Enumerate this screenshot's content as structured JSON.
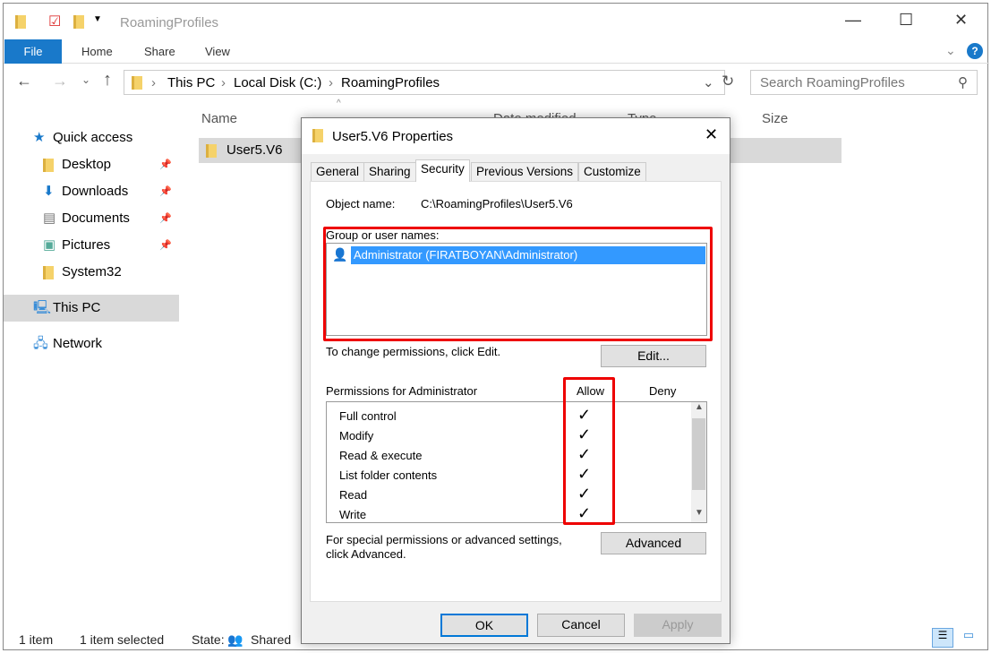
{
  "window": {
    "title": "RoamingProfiles",
    "minimize": "—",
    "maximize": "☐",
    "close": "✕"
  },
  "ribbon": {
    "tabs": [
      "File",
      "Home",
      "Share",
      "View"
    ]
  },
  "address": {
    "crumbs": [
      "This PC",
      "Local Disk (C:)",
      "RoamingProfiles"
    ],
    "search_placeholder": "Search RoamingProfiles"
  },
  "nav": {
    "items": [
      {
        "label": "Quick access",
        "icon": "star-icon"
      },
      {
        "label": "Desktop",
        "icon": "folder-icon",
        "pinned": true
      },
      {
        "label": "Downloads",
        "icon": "download-icon",
        "pinned": true
      },
      {
        "label": "Documents",
        "icon": "document-icon",
        "pinned": true
      },
      {
        "label": "Pictures",
        "icon": "pictures-icon",
        "pinned": true
      },
      {
        "label": "System32",
        "icon": "folder-icon"
      },
      {
        "label": "This PC",
        "icon": "computer-icon",
        "selected": true
      },
      {
        "label": "Network",
        "icon": "network-icon"
      }
    ]
  },
  "columns": [
    "Name",
    "Date modified",
    "Type",
    "Size"
  ],
  "files": [
    {
      "name": "User5.V6"
    }
  ],
  "status": {
    "count": "1 item",
    "selected": "1 item selected",
    "state_label": "State:",
    "state_value": "Shared"
  },
  "dialog": {
    "title": "User5.V6 Properties",
    "tabs": [
      "General",
      "Sharing",
      "Security",
      "Previous Versions",
      "Customize"
    ],
    "active_tab": "Security",
    "object_label": "Object name:",
    "object_value": "C:\\RoamingProfiles\\User5.V6",
    "group_label": "Group or user names:",
    "users": [
      "Administrator (FIRATBOYAN\\Administrator)"
    ],
    "change_text": "To change permissions, click Edit.",
    "edit": "Edit...",
    "perm_label": "Permissions for Administrator",
    "allow": "Allow",
    "deny": "Deny",
    "permissions": [
      {
        "name": "Full control",
        "allow": true,
        "deny": false
      },
      {
        "name": "Modify",
        "allow": true,
        "deny": false
      },
      {
        "name": "Read & execute",
        "allow": true,
        "deny": false
      },
      {
        "name": "List folder contents",
        "allow": true,
        "deny": false
      },
      {
        "name": "Read",
        "allow": true,
        "deny": false
      },
      {
        "name": "Write",
        "allow": true,
        "deny": false
      }
    ],
    "check": "✓",
    "special_text_1": "For special permissions or advanced settings,",
    "special_text_2": "click Advanced.",
    "advanced": "Advanced",
    "ok": "OK",
    "cancel": "Cancel",
    "apply": "Apply"
  },
  "colors": {
    "accent": "#1979ca",
    "selection": "#3399ff",
    "highlight": "#e00000"
  }
}
